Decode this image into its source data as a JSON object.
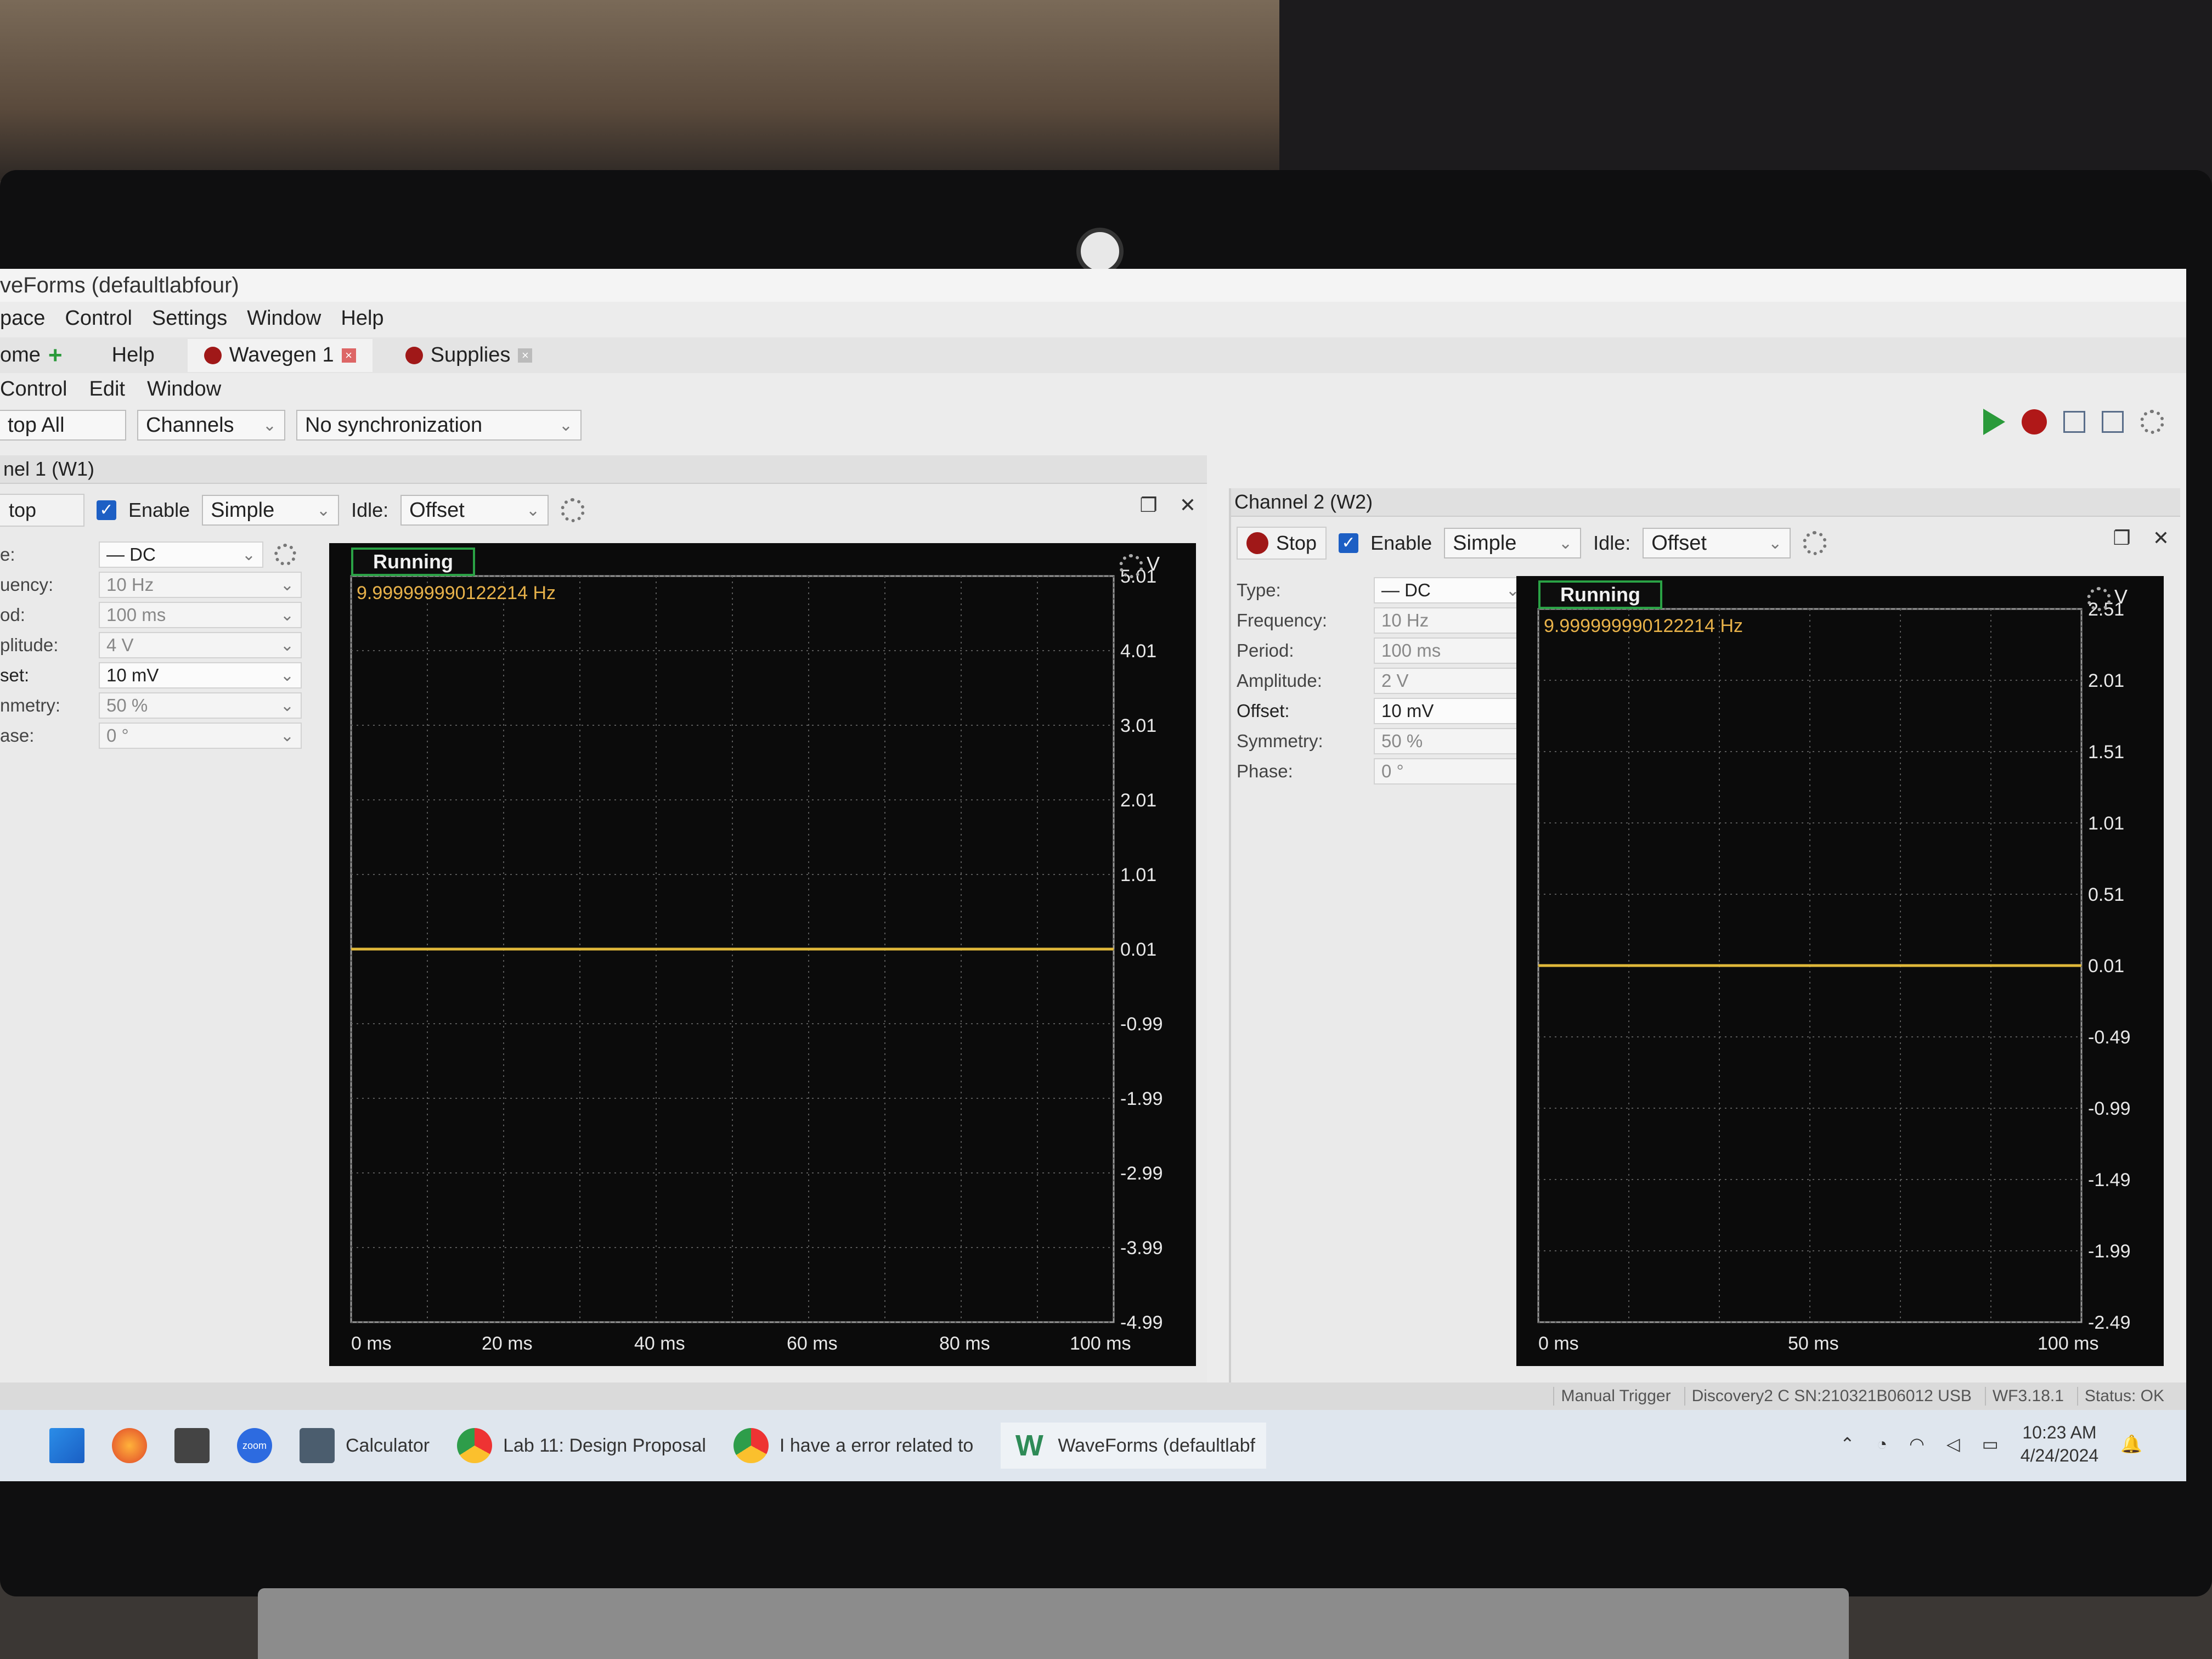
{
  "window": {
    "title": "veForms (defaultlabfour)",
    "minimize": "—",
    "restore": "❐",
    "close": "✕"
  },
  "menu": [
    "pace",
    "Control",
    "Settings",
    "Window",
    "Help"
  ],
  "tabs": {
    "home": "ome",
    "help": "Help",
    "wavegen": "Wavegen 1",
    "supplies": "Supplies"
  },
  "submenu": [
    "Control",
    "Edit",
    "Window"
  ],
  "toolbar": {
    "stop_all": "top All",
    "channels": "Channels",
    "sync": "No synchronization"
  },
  "channel1": {
    "title": "nel 1 (W1)",
    "stop": "top",
    "enable": "Enable",
    "mode": "Simple",
    "idle_label": "Idle:",
    "idle": "Offset",
    "props": [
      {
        "label": "e:",
        "value": "— DC",
        "active": true
      },
      {
        "label": "uency:",
        "value": "10 Hz",
        "active": false
      },
      {
        "label": "od:",
        "value": "100 ms",
        "active": false
      },
      {
        "label": "plitude:",
        "value": "4 V",
        "active": false
      },
      {
        "label": "set:",
        "value": "10 mV",
        "active": true
      },
      {
        "label": "nmetry:",
        "value": "50 %",
        "active": false
      },
      {
        "label": "ase:",
        "value": "0 °",
        "active": false
      }
    ],
    "plot": {
      "status": "Running",
      "frequency": "9.999999990122214 Hz",
      "unit": "V",
      "yticks": [
        "5.01",
        "4.01",
        "3.01",
        "2.01",
        "1.01",
        "0.01",
        "-0.99",
        "-1.99",
        "-2.99",
        "-3.99",
        "-4.99"
      ],
      "xticks": [
        "0 ms",
        "20 ms",
        "40 ms",
        "60 ms",
        "80 ms",
        "100 ms"
      ],
      "level": 0.01
    }
  },
  "channel2": {
    "title": "Channel 2 (W2)",
    "stop": "Stop",
    "enable": "Enable",
    "mode": "Simple",
    "idle_label": "Idle:",
    "idle": "Offset",
    "props": [
      {
        "label": "Type:",
        "value": "— DC",
        "active": true
      },
      {
        "label": "Frequency:",
        "value": "10 Hz",
        "active": false
      },
      {
        "label": "Period:",
        "value": "100 ms",
        "active": false
      },
      {
        "label": "Amplitude:",
        "value": "2 V",
        "active": false
      },
      {
        "label": "Offset:",
        "value": "10 mV",
        "active": true
      },
      {
        "label": "Symmetry:",
        "value": "50 %",
        "active": false
      },
      {
        "label": "Phase:",
        "value": "0 °",
        "active": false
      }
    ],
    "plot": {
      "status": "Running",
      "frequency": "9.999999990122214 Hz",
      "unit": "V",
      "yticks": [
        "2.51",
        "2.01",
        "1.51",
        "1.01",
        "0.51",
        "0.01",
        "-0.49",
        "-0.99",
        "-1.49",
        "-1.99",
        "-2.49"
      ],
      "xticks": [
        "0 ms",
        "50 ms",
        "100 ms"
      ],
      "level": 0.01
    }
  },
  "statusbar": {
    "trigger": "Manual Trigger",
    "device": "Discovery2 C SN:210321B06012 USB",
    "version": "WF3.18.1",
    "status": "Status: OK"
  },
  "taskbar": {
    "items": [
      "Calculator",
      "Lab 11: Design Proposal",
      "I have a error related to",
      "WaveForms (defaultlabf"
    ],
    "zoom": "zoom",
    "time": "10:23 AM",
    "date": "4/24/2024"
  },
  "colors": {
    "trace": "#e0b83a",
    "running_border": "#2aa245",
    "freq_text": "#e8b24a",
    "checkbox": "#1d5fc4",
    "stop_dot": "#a01818"
  }
}
